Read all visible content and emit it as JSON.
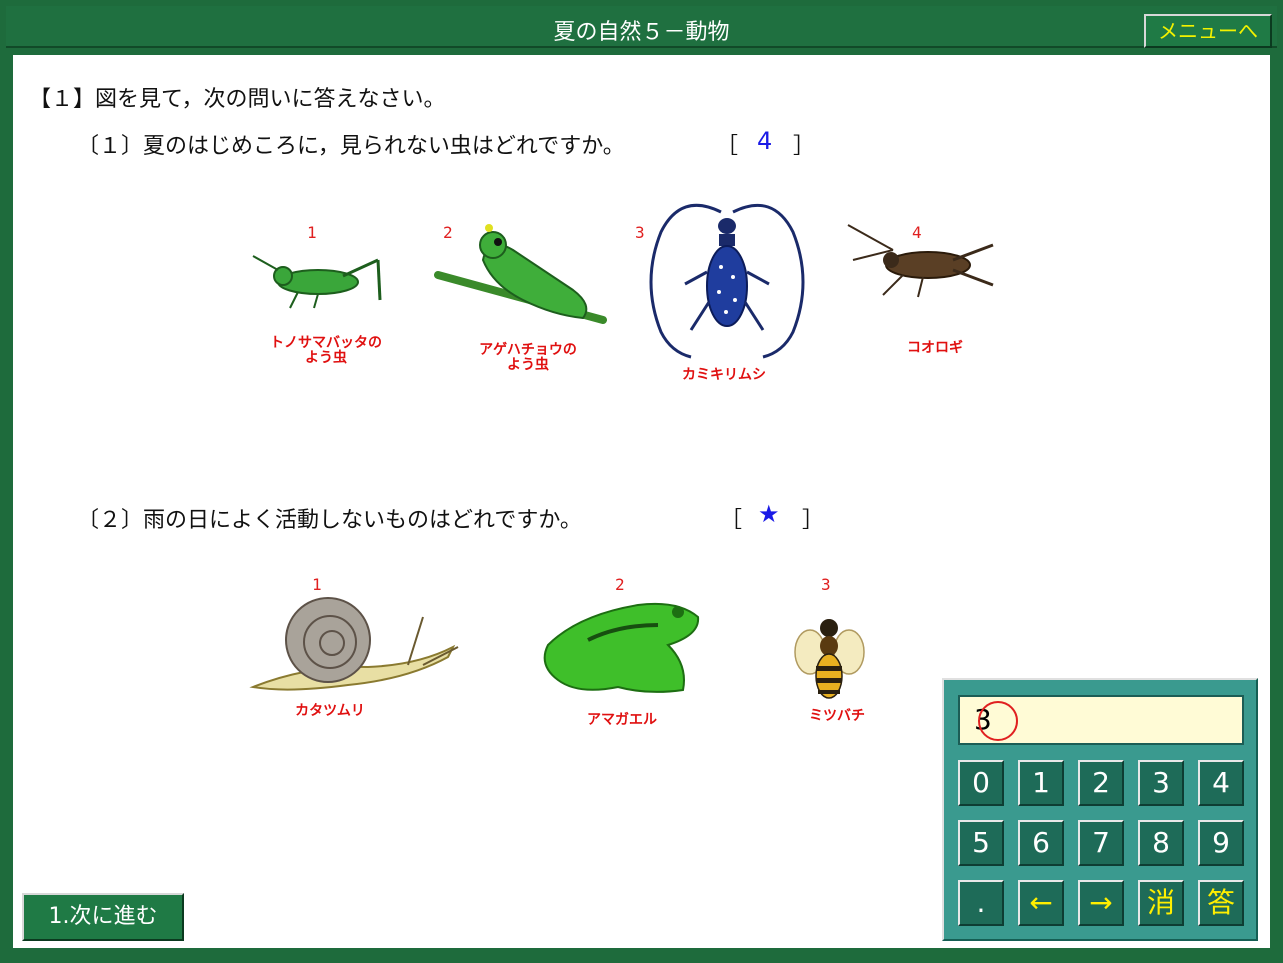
{
  "window": {
    "title": "夏の自然５－動物",
    "menu_button": "メニューへ"
  },
  "question1": {
    "heading": "【１】図を見て，次の問いに答えなさい。",
    "sub1": {
      "text": "〔１〕夏のはじめころに，見られない虫はどれですか。",
      "bracket_open": "［",
      "answer": "4",
      "bracket_close": "］",
      "choices": [
        {
          "number": "1",
          "label_line1": "トノサマバッタの",
          "label_line2": "よう虫",
          "icon": "grasshopper-nymph-icon"
        },
        {
          "number": "2",
          "label_line1": "アゲハチョウの",
          "label_line2": "よう虫",
          "icon": "caterpillar-icon"
        },
        {
          "number": "3",
          "label_line1": "カミキリムシ",
          "label_line2": "",
          "icon": "longhorn-beetle-icon"
        },
        {
          "number": "4",
          "label_line1": "コオロギ",
          "label_line2": "",
          "icon": "cricket-icon"
        }
      ]
    },
    "sub2": {
      "text": "〔２〕雨の日によく活動しないものはどれですか。",
      "bracket_open": "［",
      "answer": "★",
      "bracket_close": "］",
      "choices": [
        {
          "number": "1",
          "label": "カタツムリ",
          "icon": "snail-icon"
        },
        {
          "number": "2",
          "label": "アマガエル",
          "icon": "frog-icon"
        },
        {
          "number": "3",
          "label": "ミツバチ",
          "icon": "honeybee-icon"
        }
      ]
    }
  },
  "next_button": "1.次に進む",
  "keypad": {
    "display_value": "3",
    "keys_row1": [
      "0",
      "1",
      "2",
      "3",
      "4"
    ],
    "keys_row2": [
      "5",
      "6",
      "7",
      "8",
      "9"
    ],
    "keys_row3": [
      ".",
      "←",
      "→",
      "消",
      "答"
    ]
  },
  "colors": {
    "frame": "#1e6b3c",
    "menu_text": "#f2f200",
    "answer": "#1a1ae6",
    "choice_number": "#e02020",
    "keypad_bg": "#3a9a8f"
  }
}
